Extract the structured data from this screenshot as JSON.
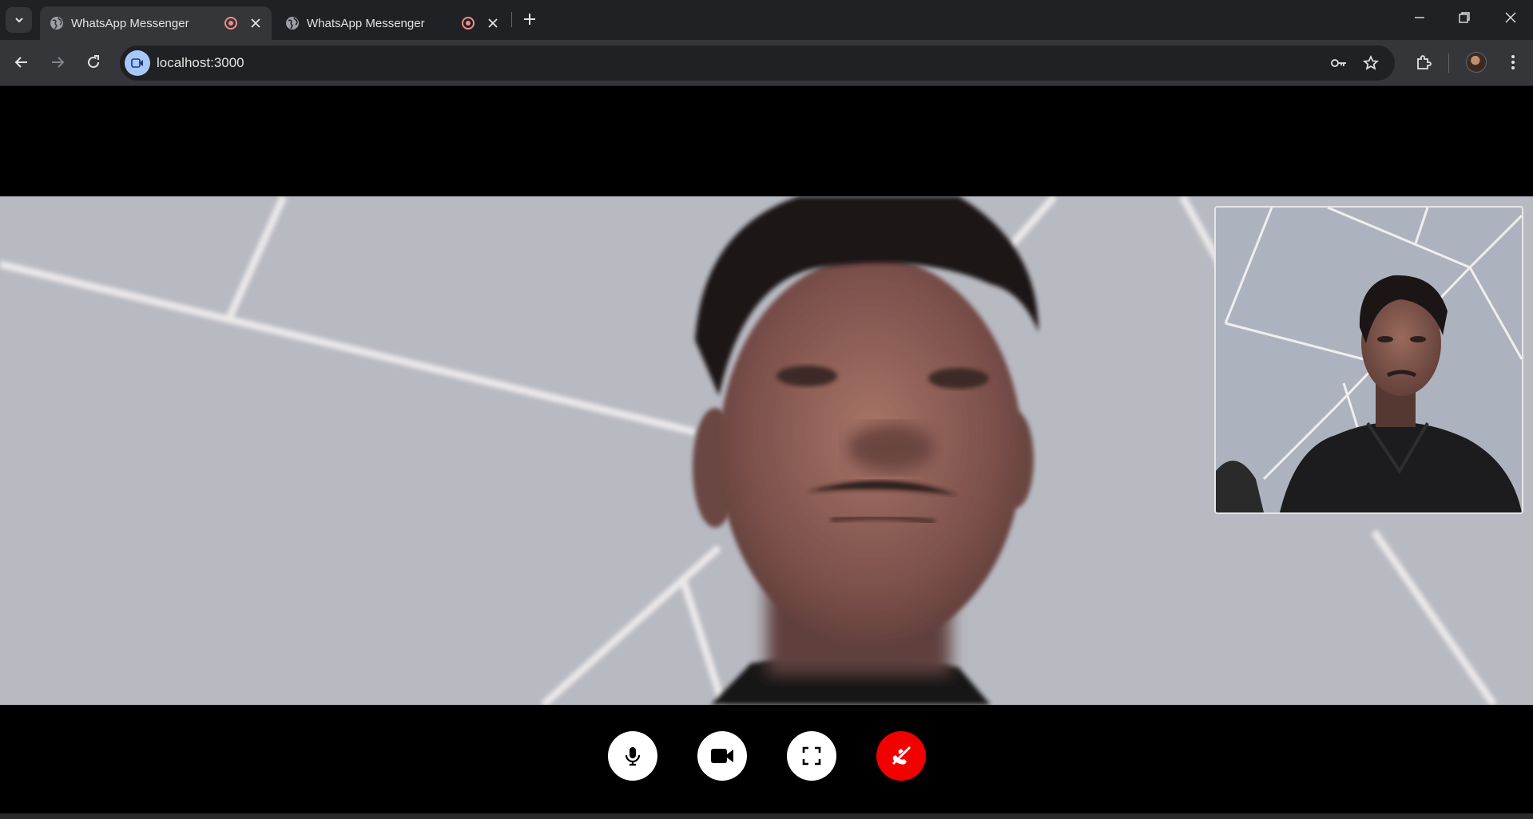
{
  "browser": {
    "tabs": [
      {
        "title": "WhatsApp Messenger",
        "active": true,
        "recording": true
      },
      {
        "title": "WhatsApp Messenger",
        "active": false,
        "recording": true
      }
    ],
    "url": "localhost:3000"
  },
  "call": {
    "remote_video": "remote-participant-video",
    "local_video": "self-preview-video",
    "controls": [
      {
        "name": "microphone",
        "icon": "mic-icon"
      },
      {
        "name": "camera",
        "icon": "video-camera-icon"
      },
      {
        "name": "fullscreen",
        "icon": "fullscreen-icon"
      },
      {
        "name": "end-call",
        "icon": "phone-hangup-icon",
        "color": "#f20000"
      }
    ]
  },
  "colors": {
    "chrome_dark": "#202124",
    "chrome_toolbar": "#35363a",
    "end_call_red": "#f20000",
    "recording_indicator": "#f28b82"
  }
}
